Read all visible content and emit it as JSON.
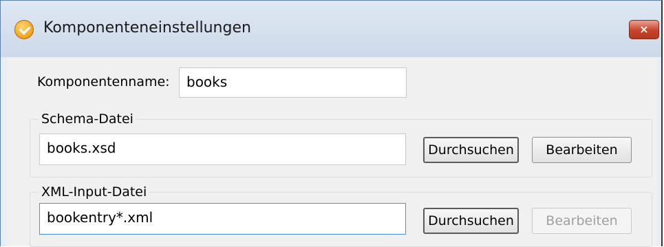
{
  "window": {
    "title": "Komponenteneinstellungen",
    "close_label": "×"
  },
  "component": {
    "label": "Komponentenname:",
    "value": "books"
  },
  "schema": {
    "legend": "Schema-Datei",
    "value": "books.xsd",
    "browse_label": "Durchsuchen",
    "edit_label": "Bearbeiten"
  },
  "xml_input": {
    "legend": "XML-Input-Datei",
    "value": "bookentry*.xml",
    "browse_label": "Durchsuchen",
    "edit_label": "Bearbeiten",
    "edit_enabled": false
  },
  "icons": {
    "app": "altova-mapforce-icon",
    "close": "close-icon"
  },
  "colors": {
    "close_button": "#c8432a",
    "focus_border": "#4b8fd6"
  }
}
